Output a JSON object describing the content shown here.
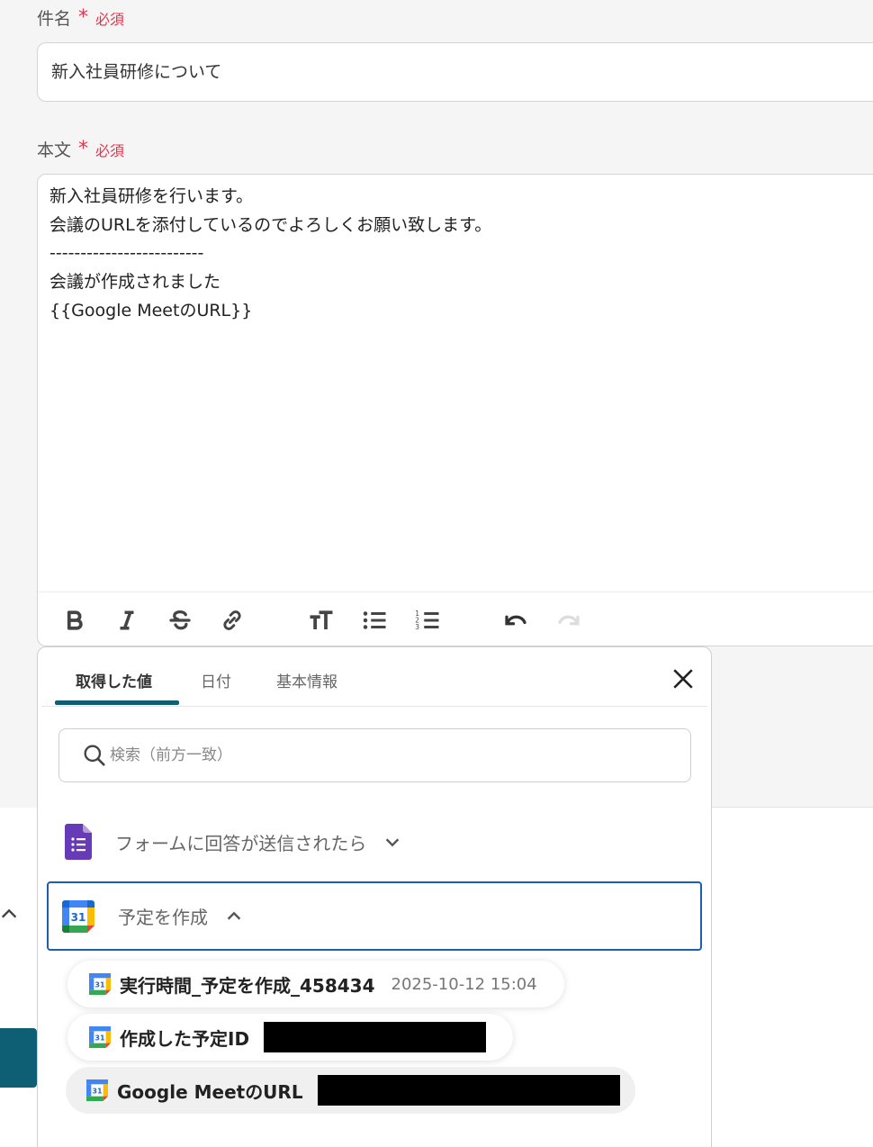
{
  "subject": {
    "label": "件名",
    "required_mark": "*",
    "required_text": "必須",
    "value": "新入社員研修について"
  },
  "body": {
    "label": "本文",
    "required_mark": "*",
    "required_text": "必須",
    "lines": [
      "新入社員研修を行います。",
      "会議のURLを添付しているのでよろしくお願い致します。",
      "-------------------------",
      "会議が作成されました",
      "{{Google MeetのURL}}"
    ]
  },
  "toolbar": {
    "icons": [
      "bold-icon",
      "italic-icon",
      "strikethrough-icon",
      "link-icon",
      "text-size-icon",
      "bullet-list-icon",
      "numbered-list-icon",
      "undo-icon",
      "redo-icon"
    ]
  },
  "panel": {
    "tabs": [
      {
        "label": "取得した値",
        "active": true
      },
      {
        "label": "日付",
        "active": false
      },
      {
        "label": "基本情報",
        "active": false
      }
    ],
    "search": {
      "placeholder": "検索（前方一致）",
      "value": ""
    },
    "sections": [
      {
        "label": "フォームに回答が送信されたら",
        "icon": "google-forms-icon",
        "expanded": false
      },
      {
        "label": "予定を作成",
        "icon": "google-calendar-icon",
        "expanded": true
      }
    ],
    "items": [
      {
        "label": "実行時間_予定を作成_458434",
        "value": "2025-10-12 15:04",
        "redacted": false
      },
      {
        "label": "作成した予定ID",
        "value": "",
        "redacted": true
      },
      {
        "label": "Google MeetのURL",
        "value": "",
        "redacted": true
      }
    ],
    "calendar_icon_text": "31"
  },
  "colors": {
    "required": "#e5334b",
    "accent": "#0e5f73",
    "focus_border": "#1a5fb4",
    "forms_purple": "#673ab7"
  }
}
